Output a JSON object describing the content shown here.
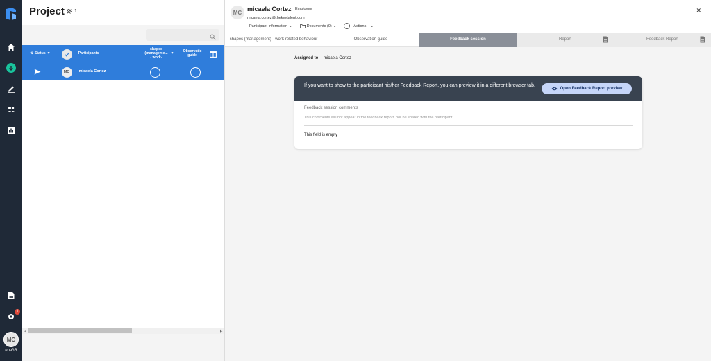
{
  "locale": "en-GB",
  "user_initials": "MC",
  "notification_count": "1",
  "colors": {
    "rail": "#1f2937",
    "accent": "#2f7ddb",
    "active_nav": "#19c39c",
    "card_header": "#394350"
  },
  "project": {
    "title": "Project",
    "participant_count": "1",
    "columns": {
      "status": "Status",
      "participants": "Participants",
      "shapes": "shapes (manageme... - work-",
      "observation": "Observatic guide"
    },
    "rows": [
      {
        "initials": "MC",
        "name": "micaela Cortez"
      }
    ]
  },
  "participant": {
    "initials": "MC",
    "name": "micaela Cortez",
    "role": "Employee",
    "email": "micaela.cortez@thekeytalent.com",
    "toolbar": {
      "info": "Participant Information",
      "documents": "Documents (0)",
      "actions": "Actions"
    }
  },
  "tabs": [
    {
      "label": "shapes (management) - work-related behaviour",
      "state": "normal"
    },
    {
      "label": "Observation guide",
      "state": "normal"
    },
    {
      "label": "Feedback session",
      "state": "active"
    },
    {
      "label": "Report",
      "state": "disabled"
    },
    {
      "label": "Feedback Report",
      "state": "disabled"
    }
  ],
  "assigned": {
    "label": "Assigned to",
    "value": "micaela Cortez"
  },
  "feedback_card": {
    "message": "If you want to show to the participant his/her Feedback Report, you can preview it in a different browser tab.",
    "button": "Open Feedback Report preview",
    "comments_label": "Feedback session comments",
    "comments_note": "This comments will not appear in the feedback report, nor be shared with the participant.",
    "empty_text": "This field is empty"
  }
}
